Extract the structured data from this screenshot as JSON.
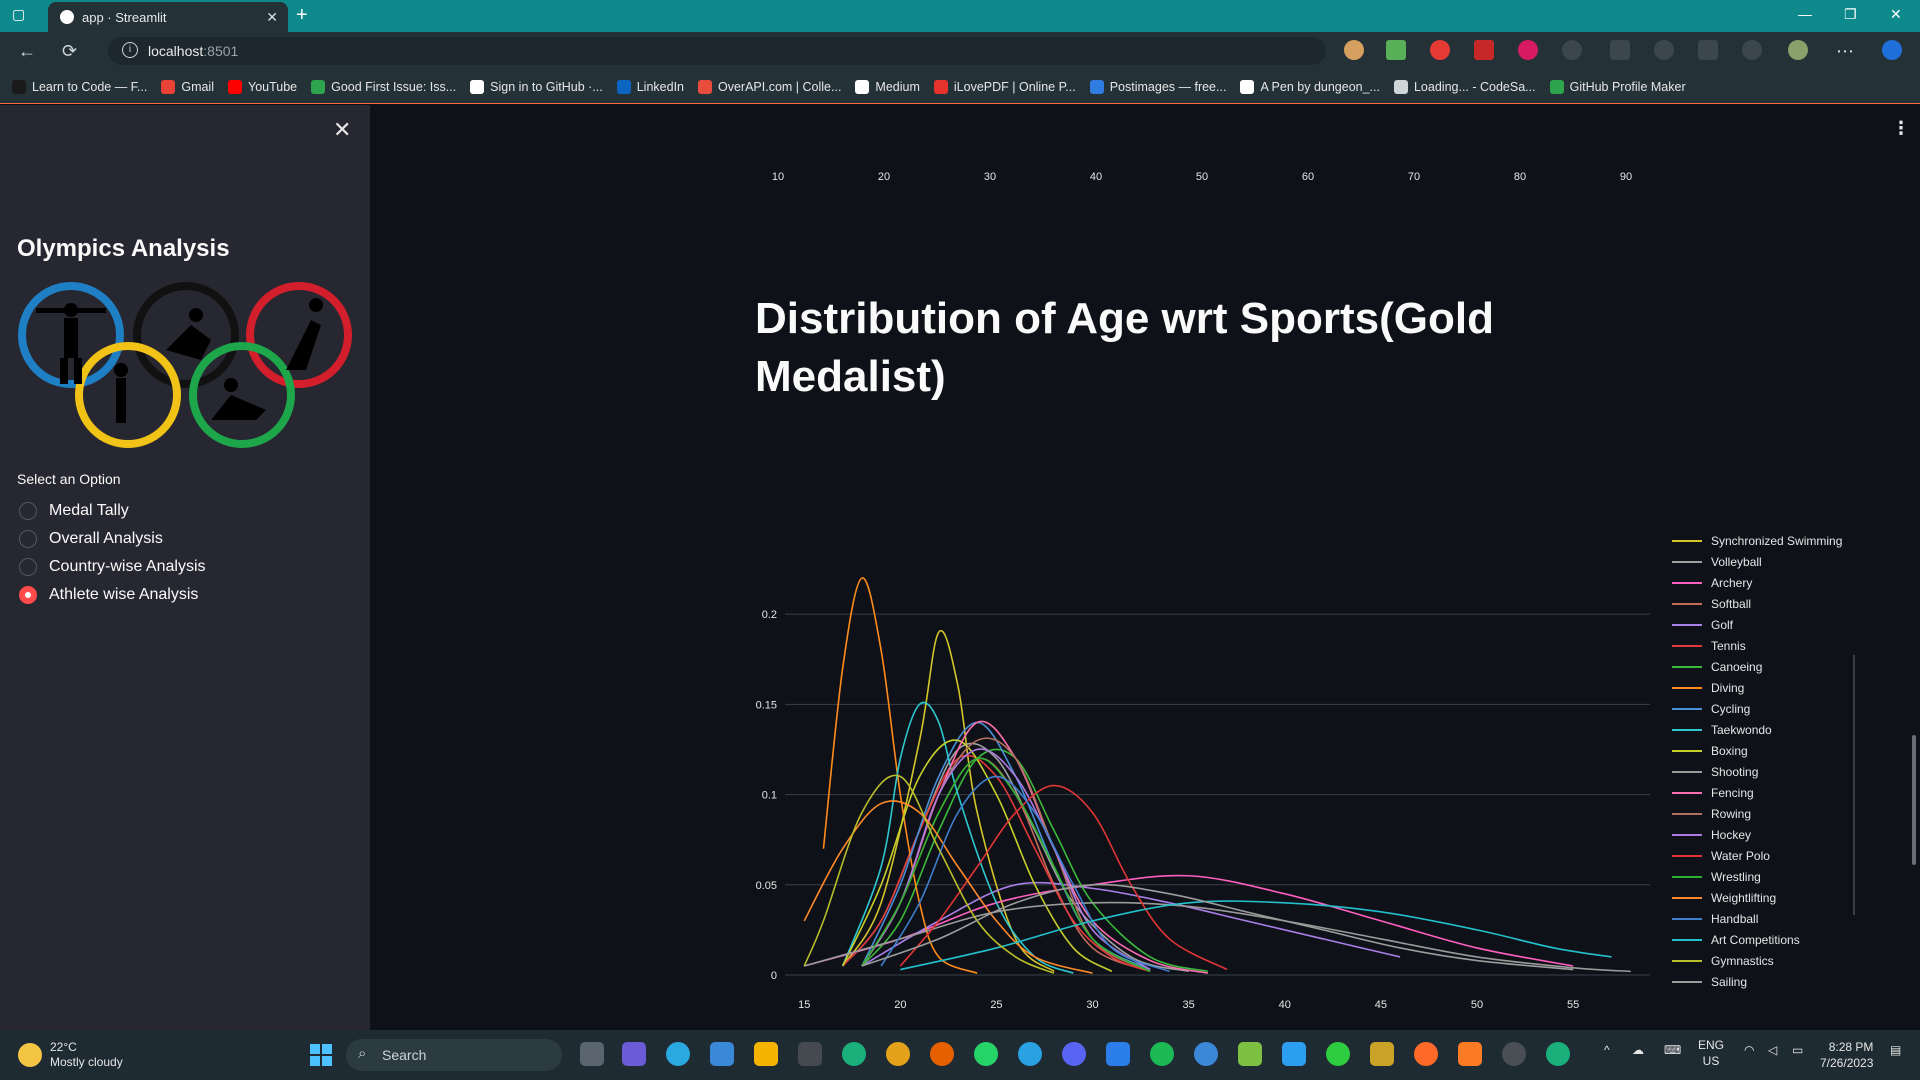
{
  "browser": {
    "tab_title": "app · Streamlit",
    "url_host": "localhost",
    "url_port": ":8501",
    "bookmarks": [
      {
        "label": "Learn to Code — F...",
        "color": "#1a1a1a"
      },
      {
        "label": "Gmail",
        "color": "#ea4335"
      },
      {
        "label": "YouTube",
        "color": "#ff0000"
      },
      {
        "label": "Good First Issue: Iss...",
        "color": "#2ea44f"
      },
      {
        "label": "Sign in to GitHub ·...",
        "color": "#ffffff"
      },
      {
        "label": "LinkedIn",
        "color": "#0a66c2"
      },
      {
        "label": "OverAPI.com | Colle...",
        "color": "#e74c3c"
      },
      {
        "label": "Medium",
        "color": "#ffffff"
      },
      {
        "label": "iLovePDF | Online P...",
        "color": "#e5322d"
      },
      {
        "label": "Postimages — free...",
        "color": "#2f7de1"
      },
      {
        "label": "A Pen by dungeon_...",
        "color": "#ffffff"
      },
      {
        "label": "Loading... - CodeSa...",
        "color": "#cfd6d8"
      },
      {
        "label": "GitHub Profile Maker",
        "color": "#2ea44f"
      }
    ]
  },
  "sidebar": {
    "title": "Olympics Analysis",
    "select_label": "Select an Option",
    "options": [
      {
        "label": "Medal Tally",
        "selected": false
      },
      {
        "label": "Overall Analysis",
        "selected": false
      },
      {
        "label": "Country-wise Analysis",
        "selected": false
      },
      {
        "label": "Athlete wise Analysis",
        "selected": true
      }
    ]
  },
  "main": {
    "top_axis_ticks": [
      "10",
      "20",
      "30",
      "40",
      "50",
      "60",
      "70",
      "80",
      "90"
    ],
    "heading": "Distribution of Age wrt Sports(Gold Medalist)"
  },
  "chart_data": {
    "type": "line",
    "title": "",
    "xlabel": "",
    "ylabel": "",
    "x_ticks": [
      15,
      20,
      25,
      30,
      35,
      40,
      45,
      50,
      55
    ],
    "y_ticks": [
      0,
      0.05,
      0.1,
      0.15,
      0.2
    ],
    "xlim": [
      14,
      59
    ],
    "ylim": [
      0,
      0.23
    ],
    "grid": true,
    "legend_position": "right",
    "series": [
      {
        "name": "Synchronized Swimming",
        "color": "#d4c52a",
        "x": [
          17,
          19,
          21,
          22,
          23,
          24,
          26,
          28
        ],
        "y": [
          0.005,
          0.04,
          0.13,
          0.19,
          0.16,
          0.09,
          0.02,
          0.002
        ]
      },
      {
        "name": "Volleyball",
        "color": "#a0a0a0",
        "x": [
          17,
          19,
          21,
          23,
          25,
          27,
          29,
          32,
          35
        ],
        "y": [
          0.005,
          0.03,
          0.08,
          0.125,
          0.12,
          0.08,
          0.04,
          0.01,
          0.002
        ]
      },
      {
        "name": "Archery",
        "color": "#ff5fc0",
        "x": [
          15,
          20,
          25,
          30,
          35,
          40,
          45,
          50,
          55
        ],
        "y": [
          0.005,
          0.02,
          0.04,
          0.05,
          0.055,
          0.045,
          0.03,
          0.015,
          0.005
        ]
      },
      {
        "name": "Softball",
        "color": "#c26b5b",
        "x": [
          18,
          20,
          22,
          24,
          26,
          28,
          30,
          33
        ],
        "y": [
          0.005,
          0.04,
          0.09,
          0.12,
          0.1,
          0.05,
          0.015,
          0.002
        ]
      },
      {
        "name": "Golf",
        "color": "#a97fe8",
        "x": [
          18,
          22,
          26,
          30,
          34,
          38,
          42,
          46
        ],
        "y": [
          0.005,
          0.03,
          0.05,
          0.048,
          0.04,
          0.03,
          0.02,
          0.01
        ]
      },
      {
        "name": "Tennis",
        "color": "#e23a3a",
        "x": [
          17,
          19,
          21,
          23,
          25,
          27,
          29,
          31,
          33
        ],
        "y": [
          0.005,
          0.03,
          0.08,
          0.12,
          0.11,
          0.07,
          0.03,
          0.01,
          0.002
        ]
      },
      {
        "name": "Canoeing",
        "color": "#3cb93c",
        "x": [
          18,
          20,
          22,
          24,
          26,
          28,
          30,
          33,
          36
        ],
        "y": [
          0.005,
          0.03,
          0.08,
          0.12,
          0.12,
          0.08,
          0.04,
          0.01,
          0.002
        ]
      },
      {
        "name": "Diving",
        "color": "#ff8c1a",
        "x": [
          16,
          17,
          18,
          19,
          20,
          21,
          22,
          24
        ],
        "y": [
          0.07,
          0.17,
          0.22,
          0.18,
          0.1,
          0.04,
          0.01,
          0.001
        ]
      },
      {
        "name": "Cycling",
        "color": "#4a8fd8",
        "x": [
          18,
          20,
          22,
          24,
          26,
          28,
          30,
          33
        ],
        "y": [
          0.005,
          0.05,
          0.11,
          0.14,
          0.11,
          0.06,
          0.02,
          0.003
        ]
      },
      {
        "name": "Taekwondo",
        "color": "#2ec7d0",
        "x": [
          17,
          19,
          20,
          21,
          22,
          23,
          25,
          27,
          29
        ],
        "y": [
          0.005,
          0.06,
          0.12,
          0.15,
          0.14,
          0.1,
          0.04,
          0.01,
          0.001
        ]
      },
      {
        "name": "Boxing",
        "color": "#c7cf2a",
        "x": [
          17,
          19,
          21,
          23,
          25,
          27,
          29,
          31
        ],
        "y": [
          0.005,
          0.05,
          0.11,
          0.13,
          0.1,
          0.05,
          0.015,
          0.002
        ]
      },
      {
        "name": "Shooting",
        "color": "#9a9a9a",
        "x": [
          15,
          20,
          25,
          30,
          35,
          40,
          45,
          50,
          55,
          58
        ],
        "y": [
          0.005,
          0.02,
          0.035,
          0.04,
          0.038,
          0.03,
          0.02,
          0.01,
          0.004,
          0.002
        ]
      },
      {
        "name": "Fencing",
        "color": "#ff6fb0",
        "x": [
          18,
          20,
          22,
          24,
          26,
          28,
          30,
          33,
          36
        ],
        "y": [
          0.005,
          0.04,
          0.1,
          0.14,
          0.12,
          0.07,
          0.03,
          0.008,
          0.001
        ]
      },
      {
        "name": "Rowing",
        "color": "#b07060",
        "x": [
          18,
          20,
          22,
          24,
          26,
          28,
          30,
          33
        ],
        "y": [
          0.005,
          0.04,
          0.1,
          0.13,
          0.12,
          0.07,
          0.02,
          0.002
        ]
      },
      {
        "name": "Hockey",
        "color": "#b07be0",
        "x": [
          18,
          20,
          22,
          24,
          26,
          28,
          30,
          33
        ],
        "y": [
          0.005,
          0.04,
          0.1,
          0.125,
          0.11,
          0.07,
          0.025,
          0.003
        ]
      },
      {
        "name": "Water Polo",
        "color": "#e03535",
        "x": [
          20,
          22,
          24,
          26,
          28,
          30,
          32,
          34,
          37
        ],
        "y": [
          0.005,
          0.03,
          0.06,
          0.09,
          0.105,
          0.09,
          0.05,
          0.02,
          0.003
        ]
      },
      {
        "name": "Wrestling",
        "color": "#2fb02f",
        "x": [
          18,
          20,
          22,
          24,
          26,
          28,
          30,
          33
        ],
        "y": [
          0.005,
          0.04,
          0.09,
          0.12,
          0.1,
          0.06,
          0.02,
          0.002
        ]
      },
      {
        "name": "Weightlifting",
        "color": "#ff8a2a",
        "x": [
          15,
          17,
          19,
          21,
          23,
          25,
          27,
          30
        ],
        "y": [
          0.03,
          0.07,
          0.095,
          0.09,
          0.06,
          0.03,
          0.01,
          0.001
        ]
      },
      {
        "name": "Handball",
        "color": "#3f7fd0",
        "x": [
          19,
          21,
          23,
          25,
          27,
          29,
          31,
          34
        ],
        "y": [
          0.005,
          0.04,
          0.09,
          0.11,
          0.09,
          0.05,
          0.015,
          0.002
        ]
      },
      {
        "name": "Art Competitions",
        "color": "#22c0cc",
        "x": [
          20,
          25,
          30,
          35,
          40,
          45,
          50,
          54,
          57
        ],
        "y": [
          0.003,
          0.015,
          0.03,
          0.04,
          0.04,
          0.035,
          0.025,
          0.015,
          0.01
        ]
      },
      {
        "name": "Gymnastics",
        "color": "#b8bd2a",
        "x": [
          15,
          16,
          18,
          20,
          22,
          24,
          26,
          28
        ],
        "y": [
          0.005,
          0.03,
          0.09,
          0.11,
          0.07,
          0.03,
          0.01,
          0.001
        ]
      },
      {
        "name": "Sailing",
        "color": "#9c9c9c",
        "x": [
          18,
          22,
          26,
          30,
          34,
          38,
          42,
          46,
          50,
          55
        ],
        "y": [
          0.005,
          0.02,
          0.04,
          0.05,
          0.045,
          0.035,
          0.025,
          0.015,
          0.008,
          0.003
        ]
      }
    ]
  },
  "taskbar": {
    "temp": "22°C",
    "weather": "Mostly cloudy",
    "search_placeholder": "Search",
    "lang": "ENG",
    "region": "US",
    "time": "8:28 PM",
    "date": "7/26/2023"
  }
}
